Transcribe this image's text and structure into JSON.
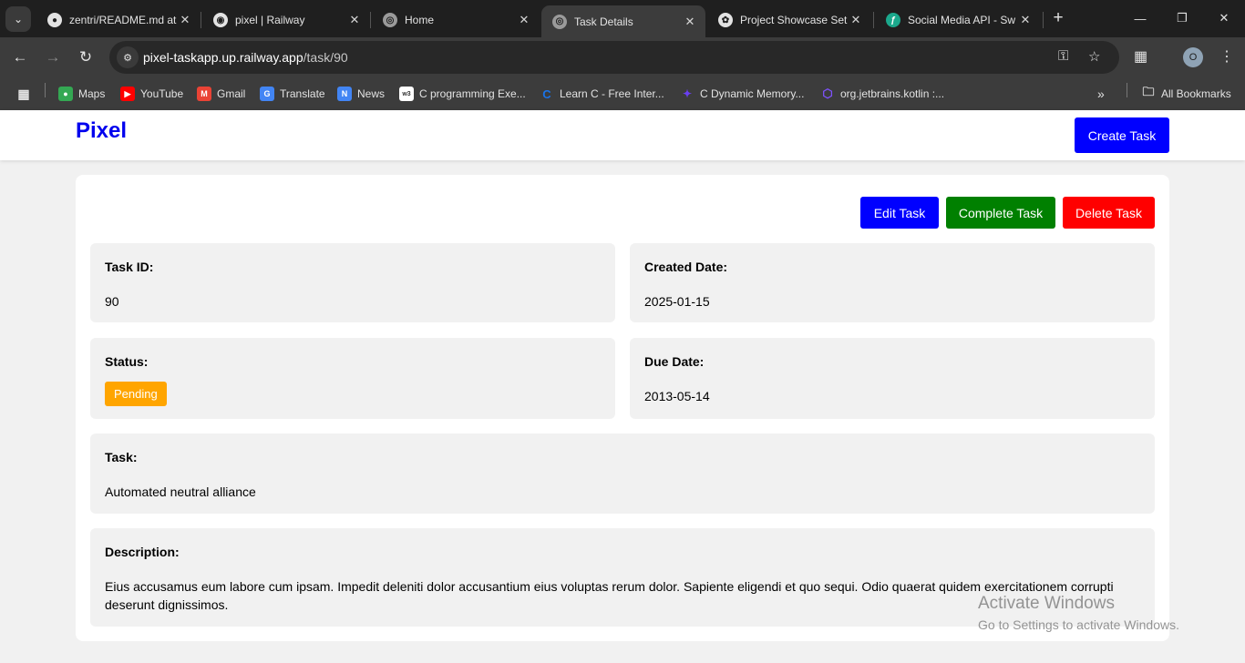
{
  "browser": {
    "tabs": [
      {
        "title": "zentri/README.md at",
        "icon": "github-icon",
        "active": false
      },
      {
        "title": "pixel | Railway",
        "icon": "railway-icon",
        "active": false
      },
      {
        "title": "Home",
        "icon": "globe-icon",
        "active": false
      },
      {
        "title": "Task Details",
        "icon": "globe-icon",
        "active": true
      },
      {
        "title": "Project Showcase Set",
        "icon": "openai-icon",
        "active": false
      },
      {
        "title": "Social Media API - Sw",
        "icon": "swagger-icon",
        "active": false
      }
    ],
    "address": {
      "host": "pixel-taskapp.up.railway.app",
      "path": "/task/90"
    },
    "profile_initial": "O",
    "bookmarks": [
      {
        "label": "Maps",
        "icon": "maps-icon",
        "color": "#34a853"
      },
      {
        "label": "YouTube",
        "icon": "youtube-icon",
        "color": "#ff0000"
      },
      {
        "label": "Gmail",
        "icon": "gmail-icon",
        "color": "#ea4335"
      },
      {
        "label": "Translate",
        "icon": "translate-icon",
        "color": "#4285f4"
      },
      {
        "label": "News",
        "icon": "news-icon",
        "color": "#4285f4"
      },
      {
        "label": "C programming Exe...",
        "icon": "w3resource-icon",
        "color": "#ffffff"
      },
      {
        "label": "Learn C - Free Inter...",
        "icon": "learn-c-icon",
        "color": "#1a73e8"
      },
      {
        "label": "C Dynamic Memory...",
        "icon": "dynamic-memory-icon",
        "color": "#6a3ff2"
      },
      {
        "label": "org.jetbrains.kotlin :...",
        "icon": "kotlin-icon",
        "color": "#7f52ff"
      }
    ],
    "all_bookmarks_label": "All Bookmarks"
  },
  "app": {
    "brand": "Pixel",
    "create_task_label": "Create Task",
    "actions": {
      "edit": "Edit Task",
      "complete": "Complete Task",
      "delete": "Delete Task"
    },
    "fields": {
      "task_id": {
        "label": "Task ID:",
        "value": "90"
      },
      "created_date": {
        "label": "Created Date:",
        "value": "2025-01-15"
      },
      "status": {
        "label": "Status:",
        "value": "Pending"
      },
      "due_date": {
        "label": "Due Date:",
        "value": "2013-05-14"
      },
      "task": {
        "label": "Task:",
        "value": "Automated neutral alliance"
      },
      "description": {
        "label": "Description:",
        "value": "Eius accusamus eum labore cum ipsam. Impedit deleniti dolor accusantium eius voluptas rerum dolor. Sapiente eligendi et quo sequi. Odio quaerat quidem exercitationem corrupti deserunt dignissimos."
      }
    },
    "colors": {
      "brand": "#0000ee",
      "primary": "#0000ff",
      "success": "#008000",
      "danger": "#ff0000",
      "pending": "#ffa500"
    }
  },
  "watermark": {
    "line1": "Activate Windows",
    "line2": "Go to Settings to activate Windows."
  }
}
